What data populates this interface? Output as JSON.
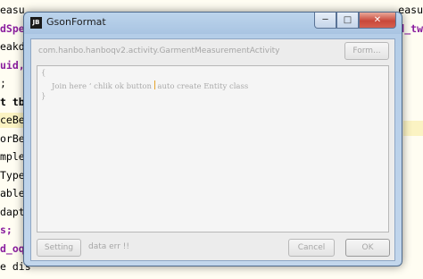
{
  "editor": {
    "left_lines": [
      {
        "text": "easu",
        "style": ""
      },
      {
        "text": "dSpec",
        "style": "purple"
      },
      {
        "text": "eakdo",
        "style": ""
      },
      {
        "text": "uid,",
        "style": "purple"
      },
      {
        "text": ";",
        "style": ""
      },
      {
        "text": "t tb",
        "style": "bold"
      },
      {
        "text": "ceBea",
        "style": "hl"
      },
      {
        "text": "orBe",
        "style": ""
      },
      {
        "text": "mple",
        "style": ""
      },
      {
        "text": "Type",
        "style": ""
      },
      {
        "text": "able",
        "style": ""
      },
      {
        "text": "dapt",
        "style": ""
      },
      {
        "text": "s;",
        "style": "purple"
      },
      {
        "text": "d_oq",
        "style": "purple"
      },
      {
        "text": "e dis",
        "style": ""
      }
    ],
    "right_lines": [
      {
        "text": "easu",
        "style": ""
      },
      {
        "text": "d_tw",
        "style": "purple"
      }
    ]
  },
  "window": {
    "app_icon": "JB",
    "title": "GsonFormat",
    "controls": {
      "minimize": "─",
      "maximize": "□",
      "close": "✕"
    }
  },
  "dialog": {
    "class_path": "com.hanbo.hanboqv2.activity.GarmentMeasurementActivity",
    "format_button": "Form...",
    "json_brace_open": "{",
    "json_hint_before": "Join here ‘ chlik  ok  button",
    "json_hint_after": "auto  create  Entity class",
    "json_brace_close": "}",
    "setting_button": "Setting",
    "status_text": "data err !!",
    "cancel_button": "Cancel",
    "ok_button": "OK"
  },
  "icons": {
    "app": "jetbrains-app-icon",
    "minimize": "minimize-icon",
    "maximize": "maximize-icon",
    "close": "close-icon"
  },
  "colors": {
    "title_bar": "#a9c4e2",
    "close_button": "#c9483a",
    "disabled_text": "#a6a6a6",
    "caret": "#e5a32b",
    "purple_code": "#8a1d9e"
  }
}
